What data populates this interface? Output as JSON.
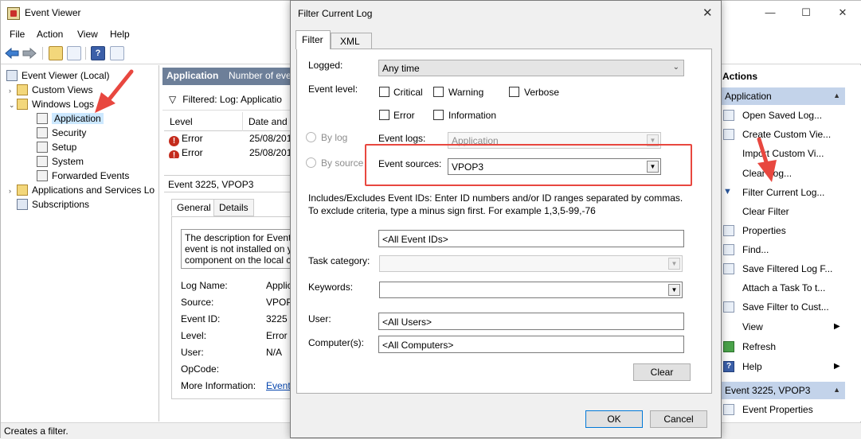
{
  "main": {
    "title": "Event Viewer",
    "menu": [
      "File",
      "Action",
      "View",
      "Help"
    ],
    "tree": [
      {
        "label": "Event Viewer (Local)",
        "expander": ""
      },
      {
        "label": "Custom Views",
        "expander": "›"
      },
      {
        "label": "Windows Logs",
        "expander": "⌄"
      },
      {
        "label": "Application",
        "expander": ""
      },
      {
        "label": "Security",
        "expander": ""
      },
      {
        "label": "Setup",
        "expander": ""
      },
      {
        "label": "System",
        "expander": ""
      },
      {
        "label": "Forwarded Events",
        "expander": ""
      },
      {
        "label": "Applications and Services Lo",
        "expander": "›"
      },
      {
        "label": "Subscriptions",
        "expander": ""
      }
    ],
    "center": {
      "header_title": "Application",
      "header_subtitle": "Number of eve",
      "filter_text": "Filtered: Log: Applicatio",
      "columns": [
        "Level",
        "Date and T"
      ],
      "rows": [
        {
          "level": "Error",
          "date": "25/08/201"
        },
        {
          "level": "Error",
          "date": "25/08/201"
        }
      ],
      "detail_title": "Event 3225, VPOP3",
      "tabs": [
        "General",
        "Details"
      ],
      "description_lines": [
        "The description for Event",
        "event is not installed on y",
        "component on the local c"
      ],
      "properties": [
        {
          "label": "Log Name:",
          "value": "Applic"
        },
        {
          "label": "Source:",
          "value": "VPOP"
        },
        {
          "label": "Event ID:",
          "value": "3225"
        },
        {
          "label": "Level:",
          "value": "Error"
        },
        {
          "label": "User:",
          "value": "N/A"
        },
        {
          "label": "OpCode:",
          "value": ""
        },
        {
          "label": "More Information:",
          "value": "Event"
        }
      ]
    },
    "status": "Creates a filter."
  },
  "actions": {
    "title": "Actions",
    "group1": "Application",
    "items": [
      "Open Saved Log...",
      "Create Custom Vie...",
      "Import Custom Vi...",
      "Clear Log...",
      "Filter Current Log...",
      "Clear Filter",
      "Properties",
      "Find...",
      "Save Filtered Log F...",
      "Attach a Task To t...",
      "Save Filter to Cust...",
      "View",
      "Refresh",
      "Help"
    ],
    "group2": "Event 3225, VPOP3",
    "items2": [
      "Event Properties"
    ]
  },
  "dialog": {
    "title": "Filter Current Log",
    "close_glyph": "✕",
    "tabs": {
      "filter": "Filter",
      "xml": "XML"
    },
    "logged_label": "Logged:",
    "logged_value": "Any time",
    "event_level_label": "Event level:",
    "levels": {
      "critical": "Critical",
      "warning": "Warning",
      "verbose": "Verbose",
      "error": "Error",
      "information": "Information"
    },
    "by_log": "By log",
    "by_source": "By source",
    "event_logs_label": "Event logs:",
    "event_logs_value": "Application",
    "event_sources_label": "Event sources:",
    "event_sources_value": "VPOP3",
    "includes_text": "Includes/Excludes Event IDs: Enter ID numbers and/or ID ranges separated by commas. To exclude criteria, type a minus sign first. For example 1,3,5-99,-76",
    "event_ids_value": "<All Event IDs>",
    "task_category_label": "Task category:",
    "keywords_label": "Keywords:",
    "user_label": "User:",
    "user_value": "<All Users>",
    "computers_label": "Computer(s):",
    "computers_value": "<All Computers>",
    "clear_button": "Clear",
    "ok_button": "OK",
    "cancel_button": "Cancel"
  },
  "colors": {
    "annotation": "#e8473f",
    "pane_header": "#6d7f99",
    "actions_group": "#c3d3ea",
    "selection": "#cce8ff"
  }
}
